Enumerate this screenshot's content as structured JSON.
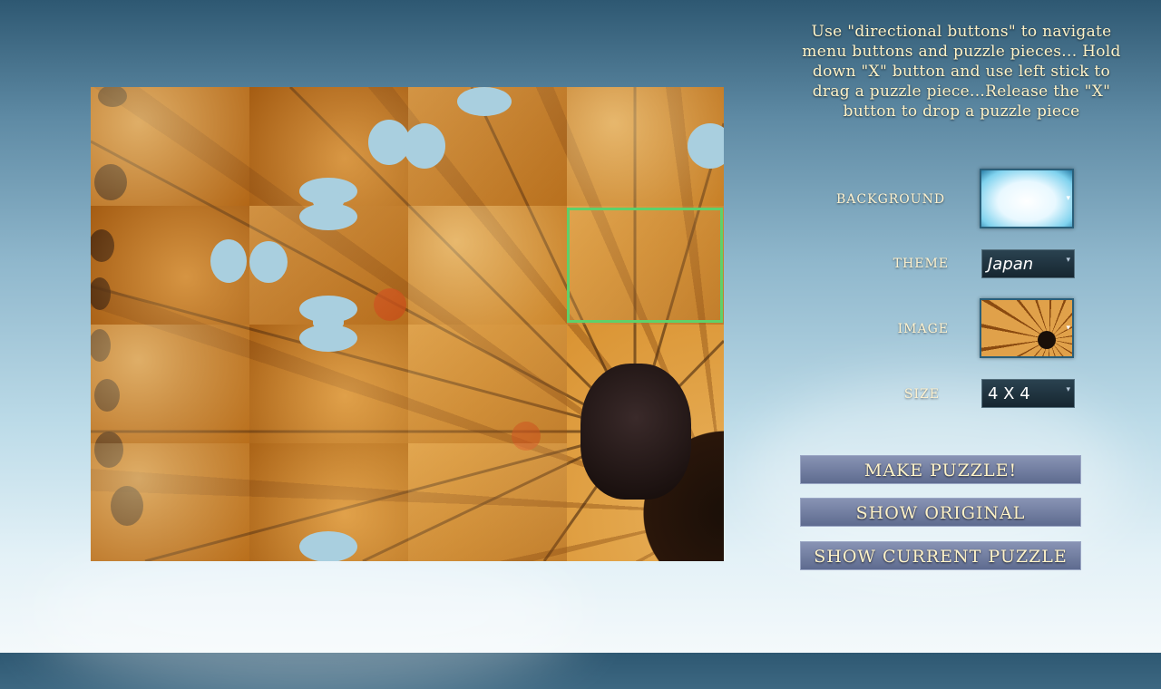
{
  "instructions": "Use \"directional buttons\" to navigate menu buttons and puzzle pieces... Hold down \"X\" button and use left stick to drag a puzzle piece...Release the \"X\" button to drop a puzzle piece",
  "settings": {
    "background_label": "BACKGROUND",
    "theme_label": "THEME",
    "theme_value": "Japan",
    "image_label": "IMAGE",
    "size_label": "SIZE",
    "size_value": "4 X 4"
  },
  "buttons": {
    "make_puzzle": "MAKE PUZZLE!",
    "show_original": "SHOW ORIGINAL",
    "show_current": "SHOW CURRENT PUZZLE"
  },
  "colors": {
    "selection_border": "#5fd06a",
    "button_fill": "#6c789b",
    "label_text": "#fff3c8"
  },
  "icons": {
    "dropdown_arrow": "chevron-down-icon"
  }
}
